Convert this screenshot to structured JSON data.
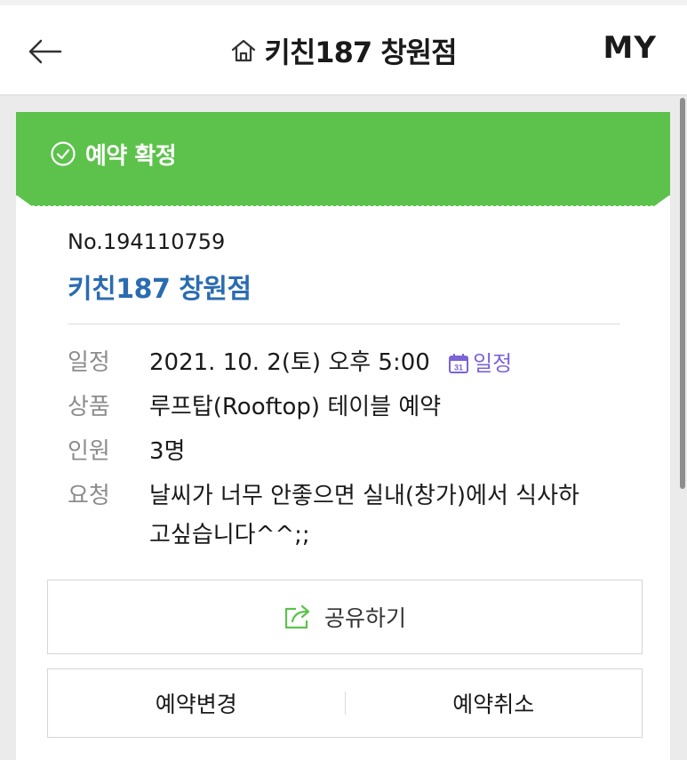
{
  "header": {
    "title": "키친187 창원점",
    "my_label": "MY"
  },
  "banner": {
    "status_text": "예약 확정",
    "color": "#5cc24b"
  },
  "reservation": {
    "number": "No.194110759",
    "store_name": "키친187 창원점",
    "rows": [
      {
        "label": "일정",
        "value": "2021. 10. 2(토) 오후 5:00",
        "link": "일정"
      },
      {
        "label": "상품",
        "value": "루프탑(Rooftop) 테이블 예약"
      },
      {
        "label": "인원",
        "value": "3명"
      },
      {
        "label": "요청",
        "value_line1": "날씨가 너무 안좋으면 실내(창가)에서 식사하",
        "value_line2": "고싶습니다^^;;"
      }
    ]
  },
  "buttons": {
    "share": "공유하기",
    "change": "예약변경",
    "cancel": "예약취소"
  },
  "icons": {
    "back": "back-arrow-icon",
    "home": "home-icon",
    "check": "check-circle-icon",
    "calendar": "calendar-icon",
    "share": "share-icon"
  },
  "colors": {
    "accent_green": "#5cc24b",
    "link_blue": "#2b6cb0",
    "calendar_purple": "#7c63d8"
  }
}
